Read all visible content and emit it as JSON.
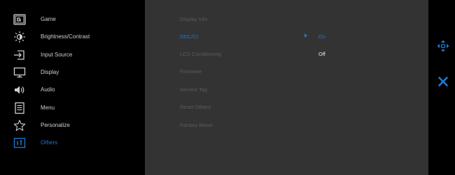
{
  "menu": {
    "items": [
      {
        "label": "Game",
        "icon": "game-icon"
      },
      {
        "label": "Brightness/Contrast",
        "icon": "brightness-icon"
      },
      {
        "label": "Input Source",
        "icon": "input-source-icon"
      },
      {
        "label": "Display",
        "icon": "display-icon"
      },
      {
        "label": "Audio",
        "icon": "audio-icon"
      },
      {
        "label": "Menu",
        "icon": "menu-icon"
      },
      {
        "label": "Personalize",
        "icon": "star-icon"
      },
      {
        "label": "Others",
        "icon": "others-icon",
        "active": true
      }
    ]
  },
  "submenu": {
    "items": [
      {
        "label": "Display Info"
      },
      {
        "label": "DDC/CI",
        "selected": true
      },
      {
        "label": "LCD Conditioning"
      },
      {
        "label": "Firmware"
      },
      {
        "label": "Service Tag"
      },
      {
        "label": "Reset Others"
      },
      {
        "label": "Factory Reset"
      }
    ]
  },
  "options": {
    "on": "On",
    "off": "Off"
  },
  "right_strip": {
    "icons": [
      "navigate-icon",
      "close-icon"
    ]
  },
  "colors": {
    "accent": "#1f78d1",
    "panel_bg": "#333333",
    "background": "#000000",
    "inactive_text": "#5c5c5c",
    "menu_text": "#cfcfcf"
  }
}
